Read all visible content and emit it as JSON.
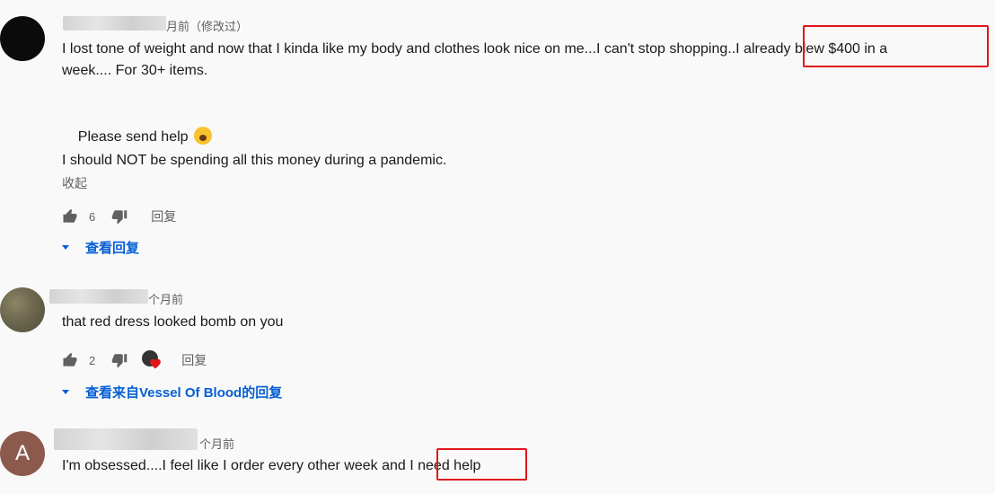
{
  "comments": [
    {
      "meta": "月前（修改过）",
      "lines": [
        "I lost tone of weight and now that I kinda like my body and clothes look nice on me...I can't stop shopping..I already blew $400 in a",
        "week.... For 30+ items.",
        "",
        "Please send help",
        "",
        "I should NOT be spending all this money during a pandemic."
      ],
      "collapse_label": "收起",
      "likes": "6",
      "reply_label": "回复",
      "view_replies": "查看回复"
    },
    {
      "meta": "个月前",
      "text": "that red dress looked bomb on you",
      "likes": "2",
      "reply_label": "回复",
      "view_replies": "查看来自Vessel Of Blood的回复"
    },
    {
      "avatar_letter": "A",
      "meta": "个月前",
      "text": "I'm obsessed....I feel like I order every other week and I need help"
    }
  ],
  "icons": {
    "like": "thumb-up-icon",
    "dislike": "thumb-down-icon",
    "caret": "caret-down-icon",
    "emoji": "screaming-face-emoji"
  },
  "colors": {
    "highlight": "#e0161b",
    "link": "#065fd4"
  }
}
